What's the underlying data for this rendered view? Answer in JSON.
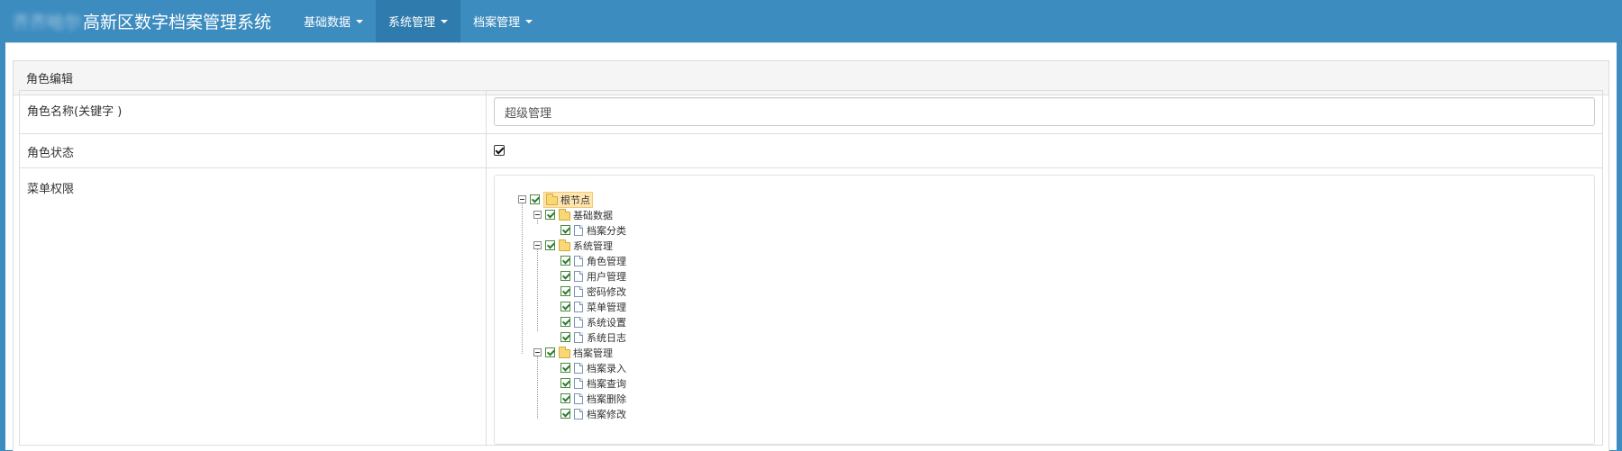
{
  "app": {
    "title_blurred": "齐齐哈尔",
    "title": "高新区数字档案管理系统"
  },
  "nav": [
    {
      "label": "基础数据"
    },
    {
      "label": "系统管理"
    },
    {
      "label": "档案管理"
    }
  ],
  "panel": {
    "heading": "角色编辑"
  },
  "form": {
    "role_name_label": "角色名称(关键字 )",
    "role_name_value": "超级管理",
    "role_status_label": "角色状态",
    "role_status_checked": true,
    "menu_permission_label": "菜单权限"
  },
  "tree": {
    "root": "根节点",
    "groups": [
      {
        "label": "基础数据",
        "children": [
          "档案分类"
        ]
      },
      {
        "label": "系统管理",
        "children": [
          "角色管理",
          "用户管理",
          "密码修改",
          "菜单管理",
          "系统设置",
          "系统日志"
        ]
      },
      {
        "label": "档案管理",
        "children": [
          "档案录入",
          "档案查询",
          "档案删除",
          "档案修改"
        ]
      }
    ]
  },
  "colors": {
    "navbar": "#3d8cc0",
    "nav_active": "#2f7bad",
    "panel_heading_bg": "#f5f5f5"
  }
}
